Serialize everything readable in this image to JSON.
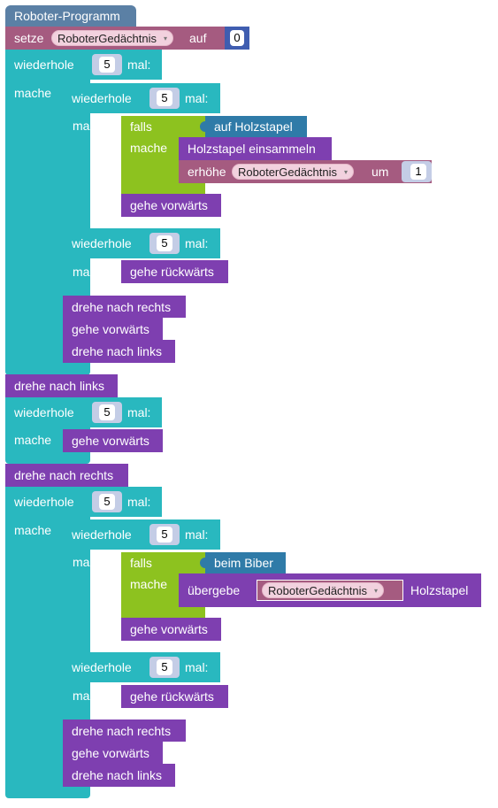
{
  "program": {
    "title": "Roboter-Programm"
  },
  "setze": {
    "label": "setze",
    "variable": "RoboterGedächtnis",
    "auf": "auf",
    "value": "0"
  },
  "loop_labels": {
    "wiederhole": "wiederhole",
    "mal": "mal:",
    "mache": "mache"
  },
  "loop_counts": {
    "outer1": "5",
    "inner1a": "5",
    "inner1b": "5",
    "outer2": "5",
    "outer3": "5",
    "inner3a": "5",
    "inner3b": "5"
  },
  "if_labels": {
    "falls": "falls",
    "mache": "mache"
  },
  "conditions": {
    "holzstapel": "auf Holzstapel",
    "biber": "beim Biber"
  },
  "actions": {
    "holzstapel_einsammeln": "Holzstapel einsammeln",
    "erhoehe": "erhöhe",
    "um": "um",
    "erhoehe_value": "1",
    "gehe_vorwaerts": "gehe vorwärts",
    "gehe_rueckwaerts": "gehe rückwärts",
    "drehe_rechts": "drehe nach rechts",
    "drehe_links": "drehe nach links",
    "uebergebe": "übergebe",
    "uebergebe_target": "Holzstapel"
  },
  "dropdown_arrow": "▾",
  "colors": {
    "program": "#5b80a5",
    "variable": "#a55b80",
    "loop": "#29b8bf",
    "if": "#8dc21f",
    "action": "#7e3fb0",
    "sensor": "#2f7ba8",
    "number": "#3f5db0"
  }
}
